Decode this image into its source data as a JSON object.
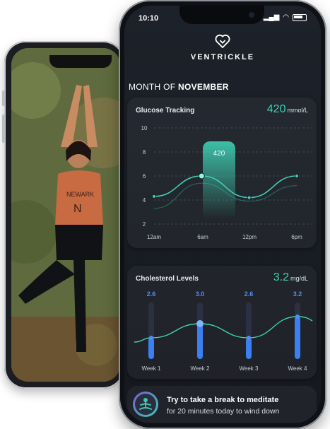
{
  "status": {
    "time": "10:10"
  },
  "brand": {
    "name": "VENTRICKLE"
  },
  "month": {
    "prefix": "MONTH OF",
    "name": "NOVEMBER"
  },
  "glucose": {
    "title": "Glucose Tracking",
    "value": "420",
    "unit": "mmol/L",
    "y_ticks": [
      "10",
      "8",
      "6",
      "4",
      "2"
    ],
    "x_ticks": [
      "12am",
      "6am",
      "12pm",
      "6pm"
    ],
    "highlight_label": "420"
  },
  "cholesterol": {
    "title": "Cholesterol Levels",
    "value": "3.2",
    "unit": "mg/dL",
    "weeks": [
      {
        "label": "Week 1",
        "value": "2.6"
      },
      {
        "label": "Week 2",
        "value": "3.0"
      },
      {
        "label": "Week 3",
        "value": "2.6"
      },
      {
        "label": "Week 4",
        "value": "3.2"
      }
    ]
  },
  "tip": {
    "title": "Try to take a break to meditate",
    "subtitle": "for 20 minutes today to wind down"
  },
  "chart_data": [
    {
      "type": "line",
      "title": "Glucose Tracking",
      "x": [
        "12am",
        "6am",
        "12pm",
        "6pm"
      ],
      "ylim": [
        2,
        10
      ],
      "series": [
        {
          "values": [
            4.3,
            6.0,
            4.2,
            6.0
          ]
        },
        {
          "values": [
            3.3,
            5.4,
            3.9,
            5.2
          ]
        }
      ]
    },
    {
      "type": "bar",
      "title": "Cholesterol Levels",
      "categories": [
        "Week 1",
        "Week 2",
        "Week 3",
        "Week 4"
      ],
      "values": [
        2.6,
        3.0,
        2.6,
        3.2
      ]
    }
  ],
  "colors": {
    "accent": "#3fd1b5",
    "bar": "#3b7ff1",
    "bg": "#1a1e25"
  }
}
